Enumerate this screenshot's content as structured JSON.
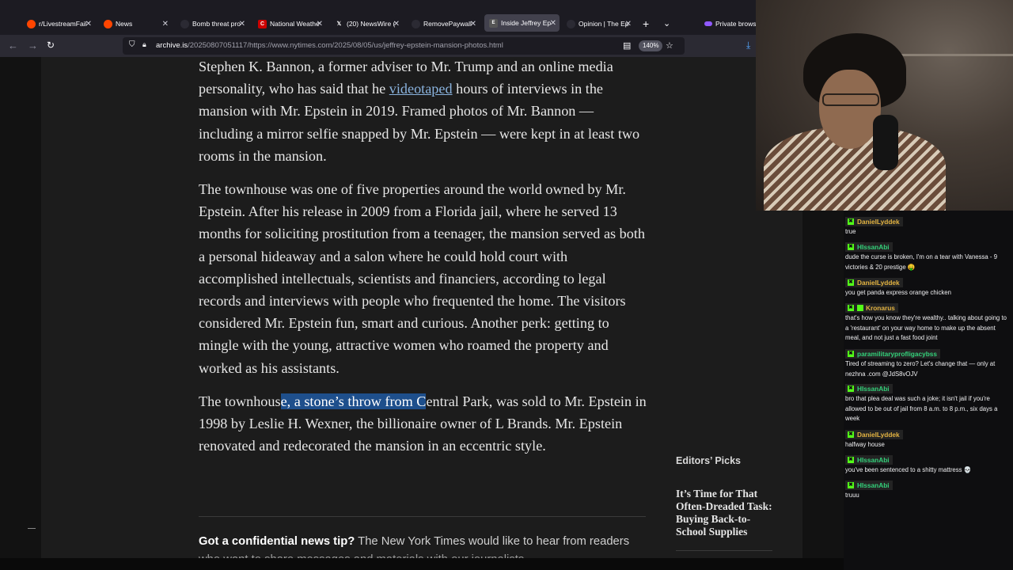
{
  "browser": {
    "tabs": [
      {
        "title": "r/LivestreamFail",
        "favicon": "reddit-icon",
        "color": "#ff4500"
      },
      {
        "title": "News",
        "favicon": "reddit-icon",
        "color": "#ff4500"
      },
      {
        "title": "Bomb threat pro",
        "favicon": "page-icon",
        "color": "#2b2a33"
      },
      {
        "title": "National Weathe",
        "favicon": "cnn-icon",
        "color": "#cc0000"
      },
      {
        "title": "(20) NewsWire (",
        "favicon": "x-icon",
        "color": "#000000"
      },
      {
        "title": "RemovePaywall",
        "favicon": "page-icon",
        "color": "#2b2a33"
      },
      {
        "title": "Inside Jeffrey Ep",
        "favicon": "archive-icon",
        "color": "#555555"
      },
      {
        "title": "Opinion | The Ep",
        "favicon": "page-icon",
        "color": "#2b2a33"
      }
    ],
    "active_tab_index": 6,
    "new_tab_label": "+",
    "private_label": "Private browsi",
    "url_domain": "archive.is",
    "url_rest": "/20250807051117/https://www.nytimes.com/2025/08/05/us/jeffrey-epstein-mansion-photos.html",
    "zoom": "140%"
  },
  "article": {
    "p1_a": "Stephen K. Bannon, a former adviser to Mr. Trump and an online media personality, who has said that he ",
    "p1_link": "videotaped",
    "p1_b": " hours of interviews in the mansion with Mr. Epstein in 2019. Framed photos of Mr. Bannon — including a mirror selfie snapped by Mr. Epstein — were kept in at least two rooms in the mansion.",
    "p2": "The townhouse was one of five properties around the world owned by Mr. Epstein. After his release in 2009 from a Florida jail, where he served 13 months for soliciting prostitution from a teenager, the mansion served as both a personal hideaway and a salon where he could hold court with accomplished intellectuals, scientists and financiers, according to legal records and interviews with people who frequented the home. The visitors considered Mr. Epstein fun, smart and curious. Another perk: getting to mingle with the young, attractive women who roamed the property and worked as his assistants.",
    "p3_a": "The townhous",
    "p3_sel": "e, a stone’s throw from C",
    "p3_b": "entral Park, was sold to Mr. Epstein in 1998 by Leslie H. Wexner, the billionaire owner of L Brands. Mr. Epstein renovated and redecorated the mansion in an eccentric style.",
    "tip_bold": "Got a confidential news tip?",
    "tip_text": " The New York Times would like to hear from readers",
    "tip_line2": "who want to share messages and materials with our journalists."
  },
  "sidebar": {
    "editors_picks": "Editors’ Picks",
    "pick_title": "It’s Time for That Often-Dreaded Task: Buying Back-to-School Supplies"
  },
  "chat": [
    {
      "user": "DanielLyddek",
      "gold": true,
      "text": "true"
    },
    {
      "user": "HIssanAbi",
      "gold": false,
      "text": "dude the curse is broken, I'm on a tear with Vanessa - 9 victories & 20 prestige 🤑"
    },
    {
      "user": "DanielLyddek",
      "gold": true,
      "text": "you get panda express orange chicken"
    },
    {
      "user": "Kronarus",
      "gold": true,
      "text": "that's how you know they're wealthy.. talking about going to a 'restaurant' on your way home to make up the absent meal, and not just a fast food joint"
    },
    {
      "user": "paramilitaryprofligacybss",
      "gold": false,
      "text": "Tired of streaming to zero? Let's change that — only at nezhna .com @JdS8vOJV"
    },
    {
      "user": "HIssanAbi",
      "gold": false,
      "text": "bro that plea deal was such a joke; it isn't jail if you're allowed to be out of jail from 8 a.m. to 8 p.m., six days a week"
    },
    {
      "user": "DanielLyddek",
      "gold": true,
      "text": "halfway house"
    },
    {
      "user": "HIssanAbi",
      "gold": false,
      "text": "you've been sentenced to a shitty mattress 💀"
    },
    {
      "user": "HIssanAbi",
      "gold": false,
      "text": "truuu"
    }
  ]
}
